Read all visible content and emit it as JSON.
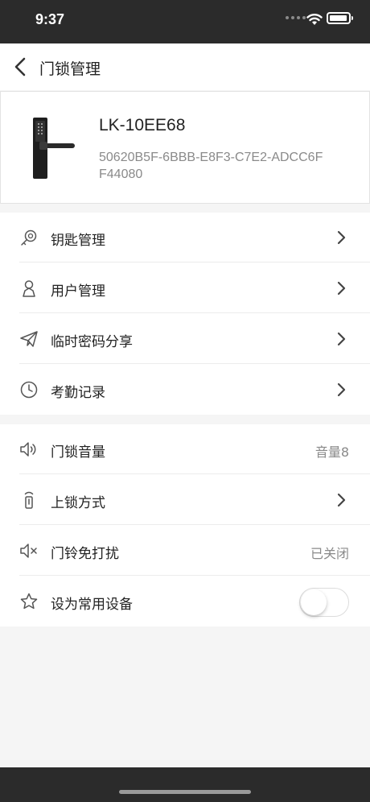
{
  "status_bar": {
    "time": "9:37"
  },
  "nav": {
    "title": "门锁管理"
  },
  "device": {
    "name": "LK-10EE68",
    "id": "50620B5F-6BBB-E8F3-C7E2-ADCC6FF44080"
  },
  "menu_group_1": [
    {
      "label": "钥匙管理",
      "icon": "key-icon"
    },
    {
      "label": "用户管理",
      "icon": "user-icon"
    },
    {
      "label": "临时密码分享",
      "icon": "paper-plane-icon"
    },
    {
      "label": "考勤记录",
      "icon": "clock-icon"
    }
  ],
  "menu_group_2": {
    "volume": {
      "label": "门锁音量",
      "value": "音量8",
      "icon": "speaker-icon"
    },
    "lock_mode": {
      "label": "上锁方式",
      "icon": "lock-mode-icon"
    },
    "doorbell_dnd": {
      "label": "门铃免打扰",
      "value": "已关闭",
      "icon": "mute-icon"
    },
    "favorite": {
      "label": "设为常用设备",
      "icon": "star-icon",
      "toggle_on": false
    }
  },
  "colors": {
    "bar_dark": "#2b2b2b",
    "page_bg": "#f5f5f5",
    "muted_text": "#8a8a8a"
  }
}
